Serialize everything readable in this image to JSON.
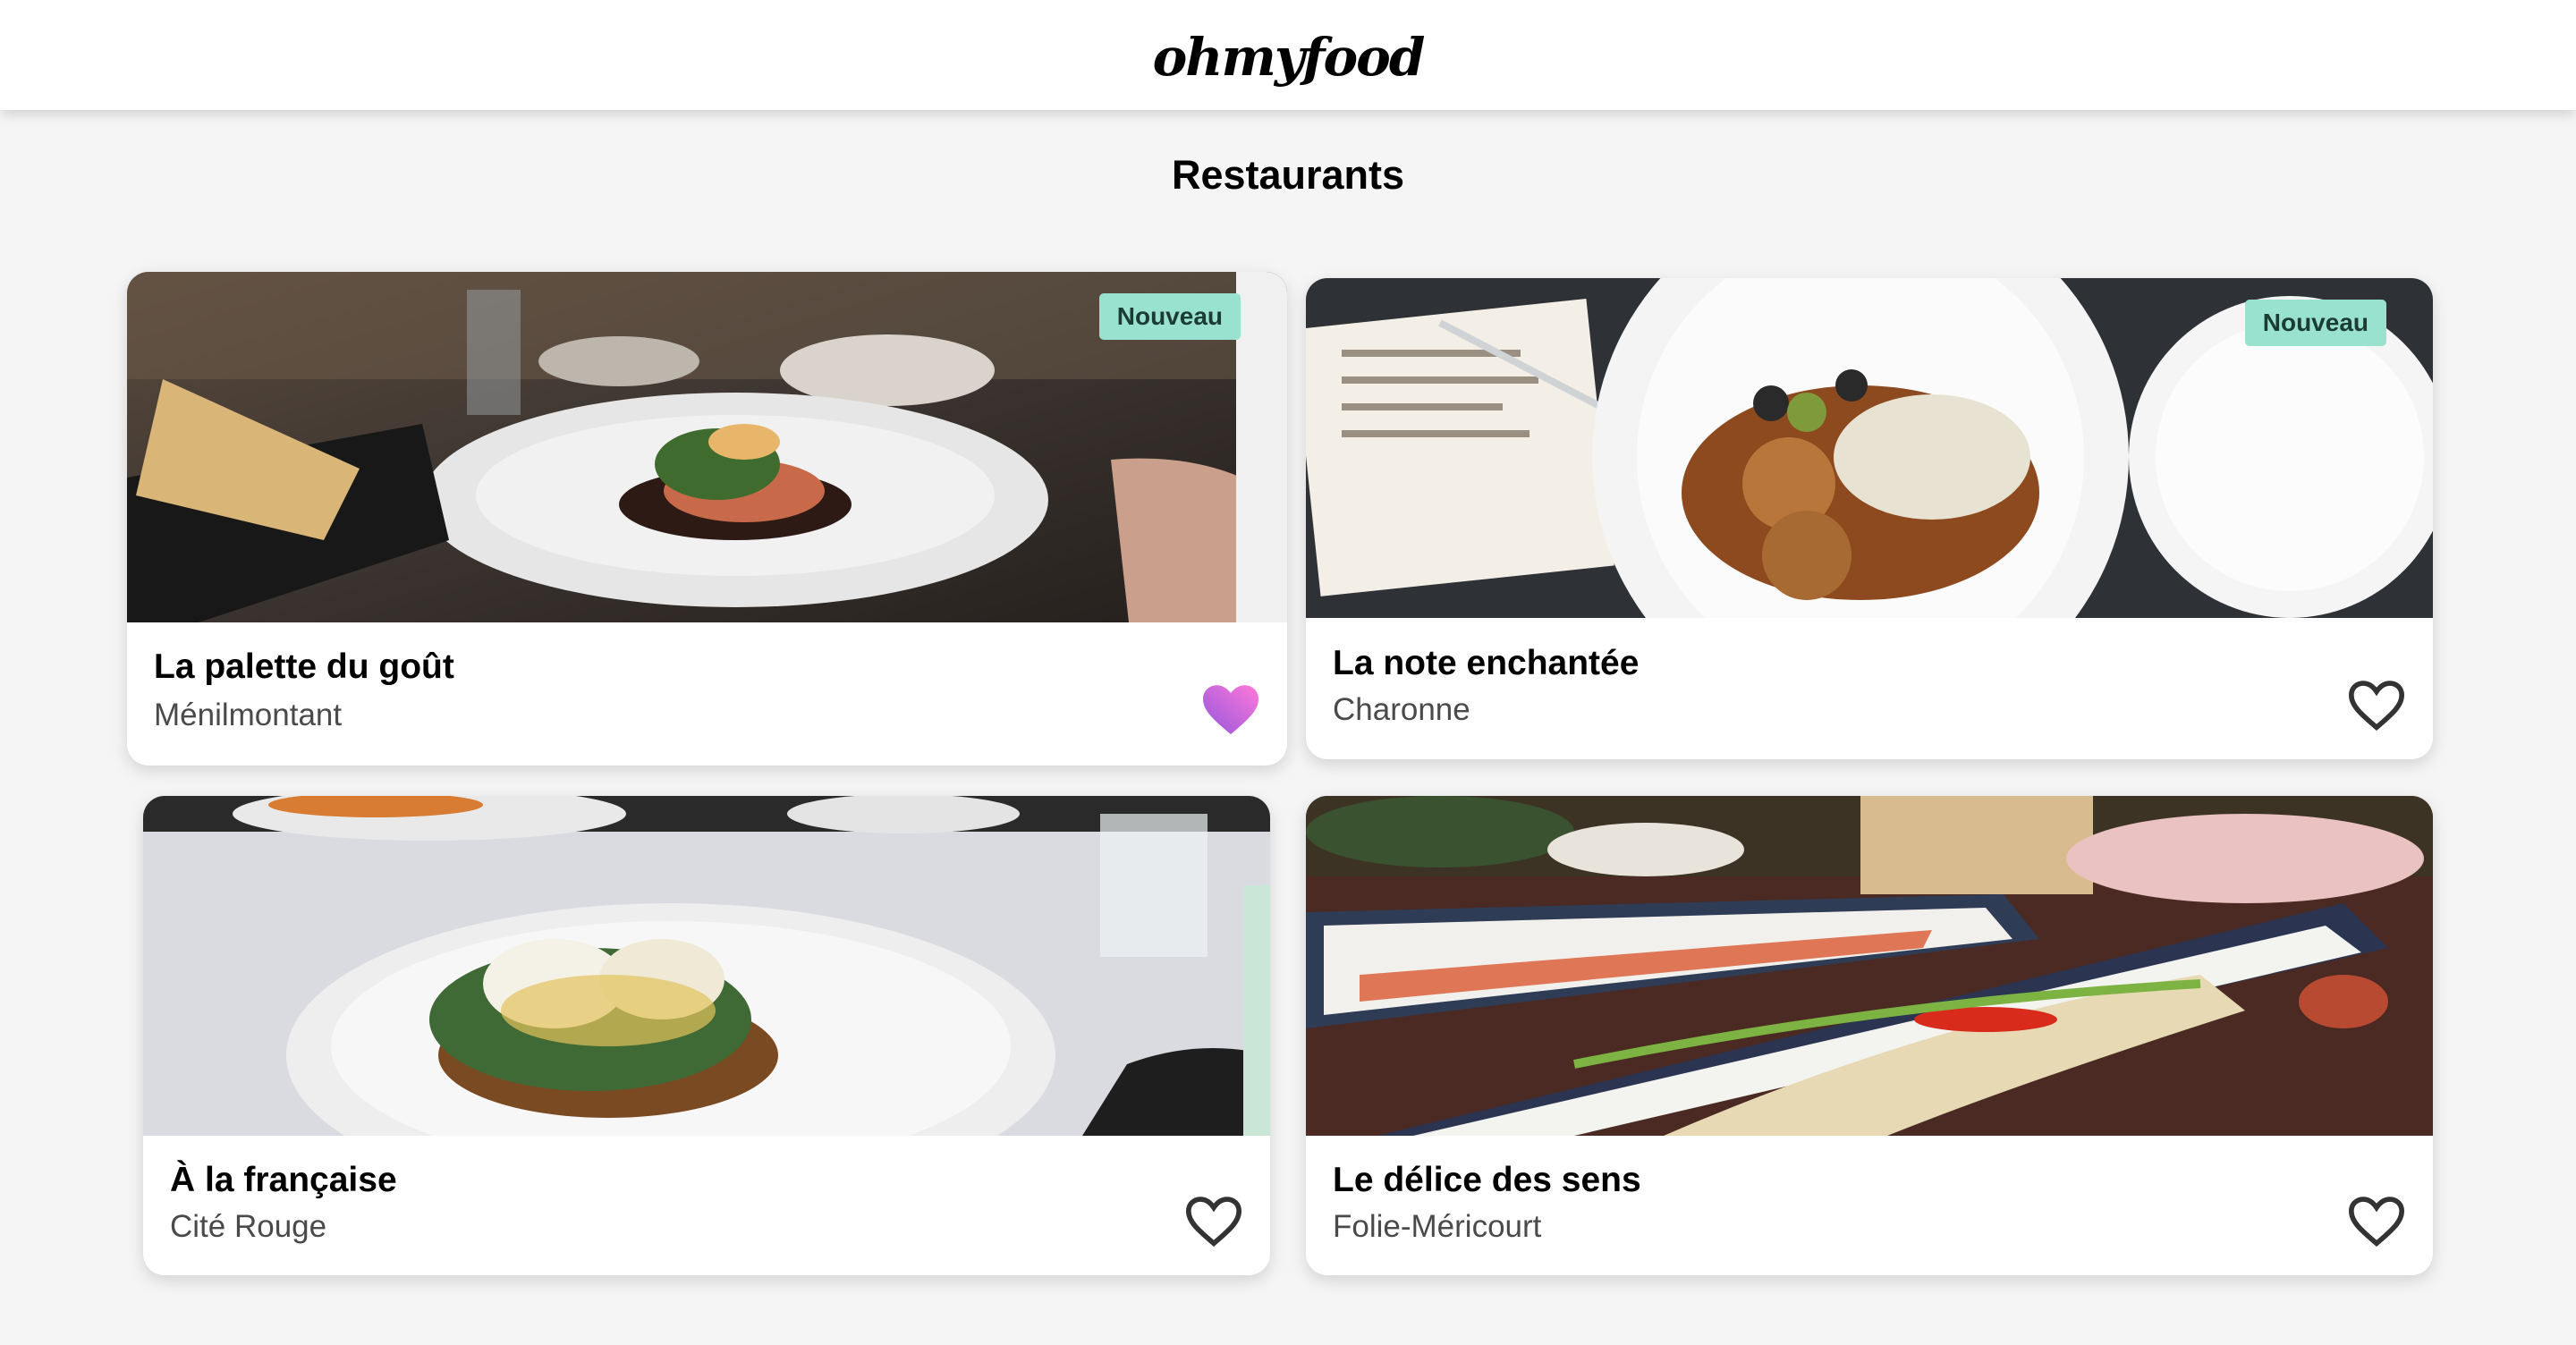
{
  "header": {
    "logo": "ohmyfood"
  },
  "main": {
    "title": "Restaurants",
    "restaurants": [
      {
        "name": "La palette du goût",
        "location": "Ménilmontant",
        "badge": "Nouveau",
        "liked": true
      },
      {
        "name": "La note enchantée",
        "location": "Charonne",
        "badge": "Nouveau",
        "liked": false
      },
      {
        "name": "À la française",
        "location": "Cité Rouge",
        "badge": "",
        "liked": false
      },
      {
        "name": "Le délice des sens",
        "location": "Folie-Méricourt",
        "badge": "",
        "liked": false
      }
    ]
  },
  "colors": {
    "badge_bg": "#99e2d0",
    "badge_text": "#1b3c33",
    "heart_liked_start": "#9356dc",
    "heart_liked_end": "#ff79da",
    "heart_outline": "#333333"
  }
}
